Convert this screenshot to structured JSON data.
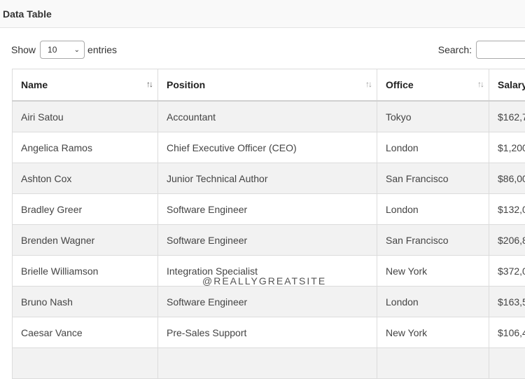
{
  "header": {
    "title": "Data Table"
  },
  "controls": {
    "show_label": "Show",
    "entries_value": "10",
    "entries_label": "entries",
    "search_label": "Search:"
  },
  "table": {
    "columns": [
      "Name",
      "Position",
      "Office",
      "Salary"
    ],
    "rows": [
      [
        "Airi Satou",
        "Accountant",
        "Tokyo",
        "$162,7"
      ],
      [
        "Angelica Ramos",
        "Chief Executive Officer (CEO)",
        "London",
        "$1,200"
      ],
      [
        "Ashton Cox",
        "Junior Technical Author",
        "San Francisco",
        "$86,00"
      ],
      [
        "Bradley Greer",
        "Software Engineer",
        "London",
        "$132,0"
      ],
      [
        "Brenden Wagner",
        "Software Engineer",
        "San Francisco",
        "$206,8"
      ],
      [
        "Brielle Williamson",
        "Integration Specialist",
        "New York",
        "$372,0"
      ],
      [
        "Bruno Nash",
        "Software Engineer",
        "London",
        "$163,5"
      ],
      [
        "Caesar Vance",
        "Pre-Sales Support",
        "New York",
        "$106,4"
      ]
    ]
  },
  "watermark": "@REALLYGREATSITE"
}
